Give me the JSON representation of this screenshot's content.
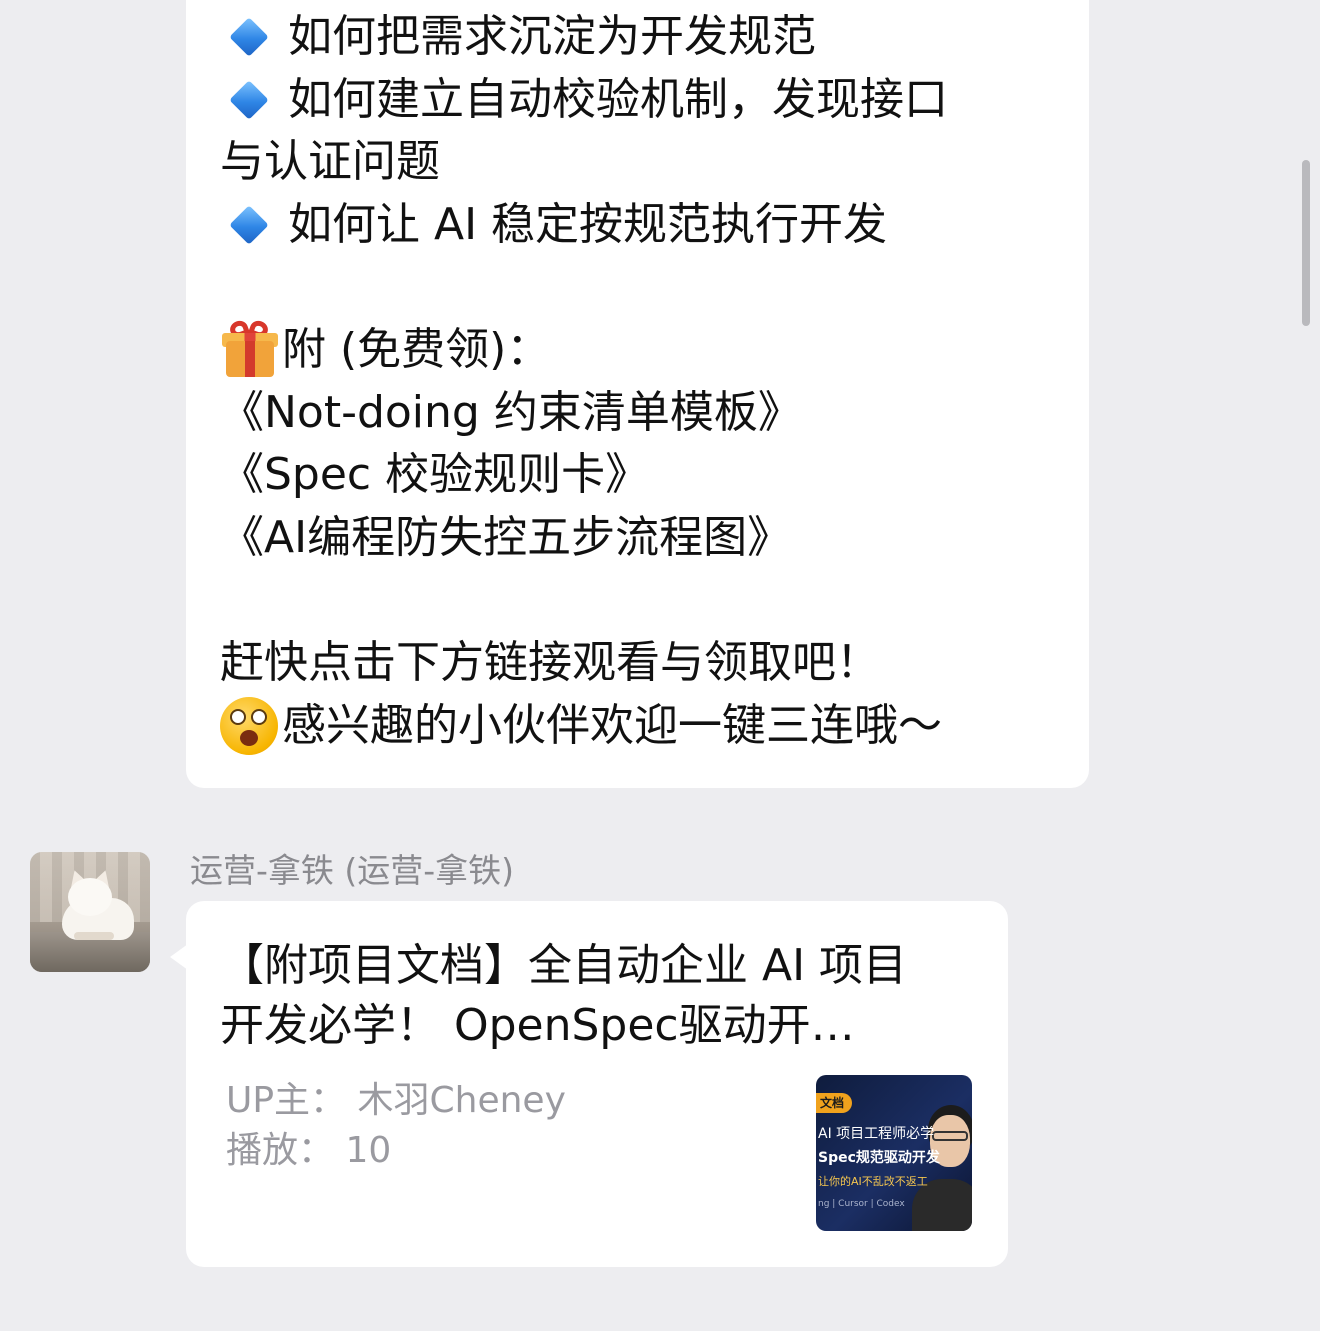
{
  "message_top": {
    "lines": [
      "如何把需求沉淀为开发规范",
      "如何建立自动校验机制，发现接口",
      "与认证问题",
      "如何让 AI 稳定按规范执行开发",
      "",
      "附 (免费领)：",
      "《Not-doing 约束清单模板》",
      "《Spec 校验规则卡》",
      "《AI编程防失控五步流程图》",
      "",
      "赶快点击下方链接观看与领取吧！",
      "感兴趣的小伙伴欢迎一键三连哦～"
    ],
    "icons": {
      "bullet": "blue-diamond-icon",
      "gift": "gift-icon",
      "face": "starstruck-face-icon"
    }
  },
  "sender": {
    "name": "运营-拿铁 (运营-拿铁)"
  },
  "card": {
    "title_line1": "【附项目文档】全自动企业 AI 项目",
    "title_line2": "开发必学！ OpenSpec驱动开…",
    "uploader": "UP主： 木羽Cheney",
    "plays": "播放： 10",
    "thumbnail": {
      "tag": "文档",
      "line1": "AI 项目工程师必学",
      "line2": "Spec规范驱动开发",
      "line3": "让你的AI不乱改不返工",
      "line4": "ng | Cursor | Codex"
    }
  }
}
